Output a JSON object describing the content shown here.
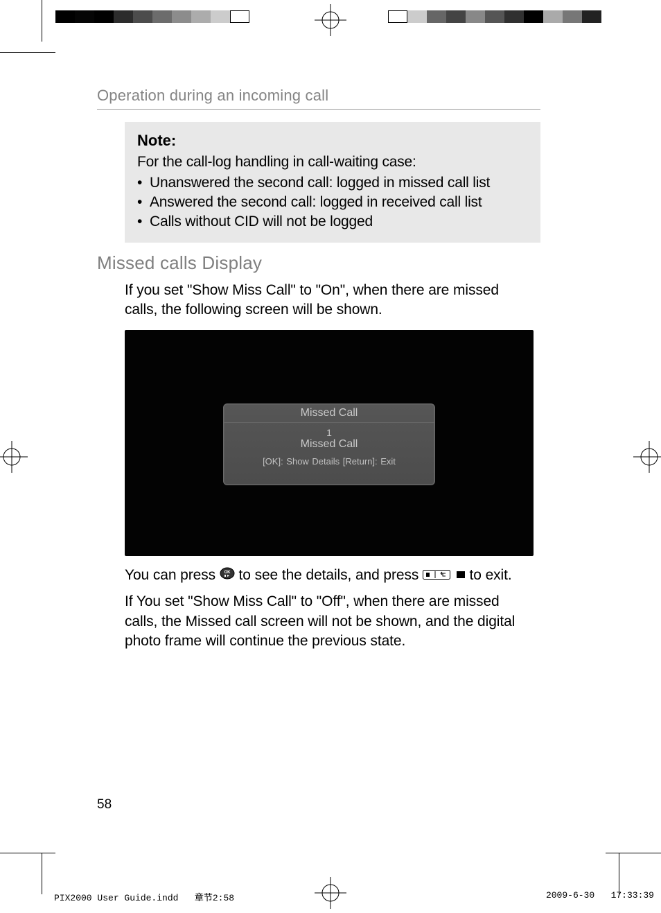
{
  "header": {
    "running_title": "Operation during an incoming call"
  },
  "note": {
    "title": "Note:",
    "intro": "For the call-log handling in call-waiting case:",
    "items": [
      "Unanswered the second call: logged in missed call list",
      "Answered the second call: logged in received call list",
      "Calls without CID will not be logged"
    ]
  },
  "section": {
    "heading": "Missed calls Display",
    "para1": "If you set \"Show Miss Call\" to \"On\", when there are missed calls, the following screen will be shown.",
    "para2_pre": "You can press ",
    "para2_mid": " to see the details, and press ",
    "para2_post": " to exit.",
    "para3": "If You set \"Show Miss Call\" to \"Off\", when there are missed calls, the Missed call screen will not be shown, and the digital photo frame will continue the previous state."
  },
  "screenshot": {
    "dialog_title": "Missed Call",
    "count": "1",
    "subtitle": "Missed Call",
    "hint": "[OK]: Show Details  [Return]: Exit"
  },
  "page_number": "58",
  "imprint": {
    "file": "PIX2000 User Guide.indd",
    "section": "章节2:58",
    "date": "2009-6-30",
    "time": "17:33:39"
  },
  "colorbar_left": [
    "#000000",
    "#050505",
    "#000000",
    "#2c2c2c",
    "#4c4c4c",
    "#6c6c6c",
    "#8c8c8c",
    "#acacac",
    "#cccccc",
    "#ffffff"
  ],
  "colorbar_right": [
    "#ffffff",
    "#cccccc",
    "#666666",
    "#444444",
    "#888888",
    "#555555",
    "#303030",
    "#000000",
    "#aaaaaa",
    "#777777",
    "#222222"
  ]
}
